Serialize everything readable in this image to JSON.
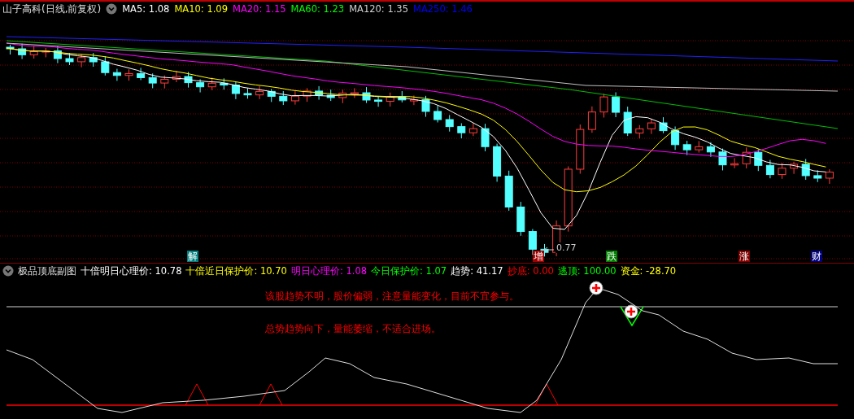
{
  "header": {
    "title": "山子高科(日线,前复权)",
    "ma": [
      {
        "label": "MA5: 1.08",
        "color": "#ffffff"
      },
      {
        "label": "MA10: 1.09",
        "color": "#ffff00"
      },
      {
        "label": "MA20: 1.15",
        "color": "#ff00ff"
      },
      {
        "label": "MA60: 1.23",
        "color": "#00ff00"
      },
      {
        "label": "MA120: 1.35",
        "color": "#d0d0d0"
      },
      {
        "label": "MA250: 1.46",
        "color": "#0000ff"
      }
    ]
  },
  "price_chart": {
    "low_label": "0.77",
    "signals": [
      {
        "label": "解",
        "color": "#008080"
      },
      {
        "label": "增",
        "color": "#a00000"
      },
      {
        "label": "跌",
        "color": "#008000"
      },
      {
        "label": "涨",
        "color": "#800000"
      },
      {
        "label": "财",
        "color": "#000080"
      }
    ]
  },
  "indicator": {
    "title": "极品顶底副图",
    "values": [
      {
        "label": "十倍明日心理价: 10.78",
        "color": "#ffffff"
      },
      {
        "label": "十倍近日保护价: 10.70",
        "color": "#ffff00"
      },
      {
        "label": "明日心理价: 1.08",
        "color": "#ff00ff"
      },
      {
        "label": "今日保护价: 1.07",
        "color": "#00ff00"
      },
      {
        "label": "趋势: 41.17",
        "color": "#ffffff"
      },
      {
        "label": "抄底: 0.00",
        "color": "#ff0000"
      },
      {
        "label": "逃顶: 100.00",
        "color": "#00ff00"
      },
      {
        "label": "资金: -28.70",
        "color": "#ffff00"
      }
    ],
    "notes": [
      "该股趋势不明，股价偏弱，注意量能变化，目前不宜参与。",
      "总势趋势向下，量能萎缩，不适合进场。"
    ]
  }
}
